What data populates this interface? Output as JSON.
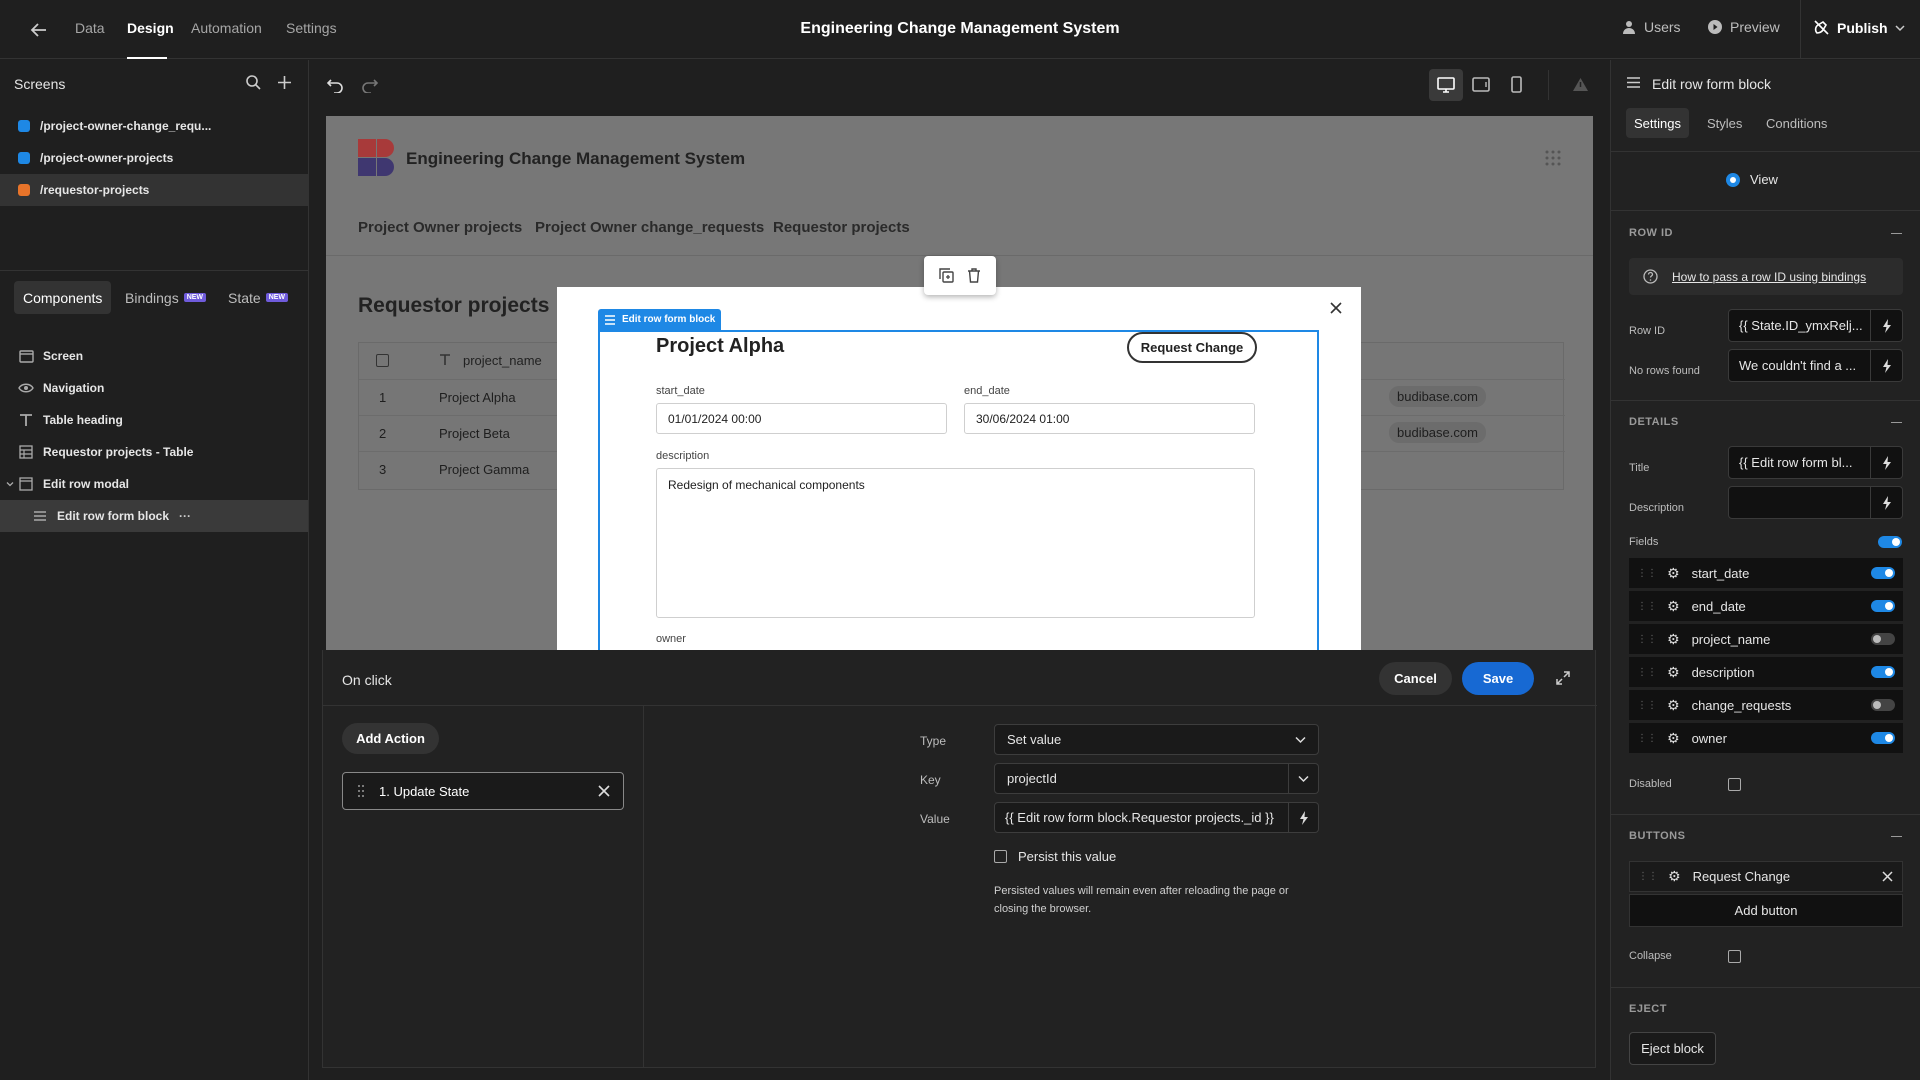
{
  "topbar": {
    "back_icon": "arrow-left-icon",
    "nav": [
      "Data",
      "Design",
      "Automation",
      "Settings"
    ],
    "title": "Engineering Change Management System",
    "users": "Users",
    "preview": "Preview",
    "publish": "Publish"
  },
  "screens": {
    "heading": "Screens",
    "items": [
      {
        "label": "/project-owner-change_requ...",
        "color": "#1e88e5"
      },
      {
        "label": "/project-owner-projects",
        "color": "#1e88e5"
      },
      {
        "label": "/requestor-projects",
        "color": "#e8742a"
      }
    ]
  },
  "component_tabs": {
    "components": "Components",
    "bindings": "Bindings",
    "state": "State",
    "new": "NEW"
  },
  "tree": [
    "Screen",
    "Navigation",
    "Table heading",
    "Requestor projects - Table",
    "Edit row modal",
    "Edit row form block"
  ],
  "tree_more": "···",
  "preview": {
    "app_title": "Engineering Change Management System",
    "nav": [
      "Project Owner projects",
      "Project Owner change_requests",
      "Requestor projects"
    ],
    "heading": "Requestor projects",
    "column": "project_name",
    "rows": [
      {
        "num": "1",
        "name": "Project Alpha",
        "email": "budibase.com"
      },
      {
        "num": "2",
        "name": "Project Beta",
        "email": "budibase.com"
      },
      {
        "num": "3",
        "name": "Project Gamma",
        "email": ""
      }
    ],
    "logo_colors": [
      "#d64545",
      "#4a3f8f"
    ]
  },
  "modal": {
    "block_label": "Edit row form block",
    "title": "Project Alpha",
    "request_change": "Request Change",
    "start_date_label": "start_date",
    "start_date": "01/01/2024 00:00",
    "end_date_label": "end_date",
    "end_date": "30/06/2024 01:00",
    "description_label": "description",
    "description": "Redesign of mechanical components",
    "owner_label": "owner"
  },
  "onclick": {
    "title": "On click",
    "cancel": "Cancel",
    "save": "Save",
    "add_action": "Add Action",
    "action": "1. Update State",
    "type_label": "Type",
    "type_value": "Set value",
    "key_label": "Key",
    "key_value": "projectId",
    "value_label": "Value",
    "value_value": "{{ Edit row form block.Requestor projects._id }}",
    "persist": "Persist this value",
    "persist_note": "Persisted values will remain even after reloading the page or closing the browser."
  },
  "settings": {
    "header": "Edit row form block",
    "tabs": [
      "Settings",
      "Styles",
      "Conditions"
    ],
    "view": "View",
    "row_id_section": "ROW ID",
    "help_link": "How to pass a row ID using bindings",
    "row_id_label": "Row ID",
    "row_id_value": "{{ State.ID_ymxRelj...",
    "no_rows_label": "No rows found",
    "no_rows_value": "We couldn't find a ...",
    "details_section": "DETAILS",
    "title_label": "Title",
    "title_value": "{{ Edit row form bl...",
    "description_label": "Description",
    "description_value": "",
    "fields_label": "Fields",
    "fields": [
      {
        "name": "start_date",
        "on": true
      },
      {
        "name": "end_date",
        "on": true
      },
      {
        "name": "project_name",
        "on": false
      },
      {
        "name": "description",
        "on": true
      },
      {
        "name": "change_requests",
        "on": false
      },
      {
        "name": "owner",
        "on": true
      }
    ],
    "disabled_label": "Disabled",
    "buttons_section": "BUTTONS",
    "button_item": "Request Change",
    "add_button": "Add button",
    "collapse_label": "Collapse",
    "eject_section": "EJECT",
    "eject_button": "Eject block"
  }
}
